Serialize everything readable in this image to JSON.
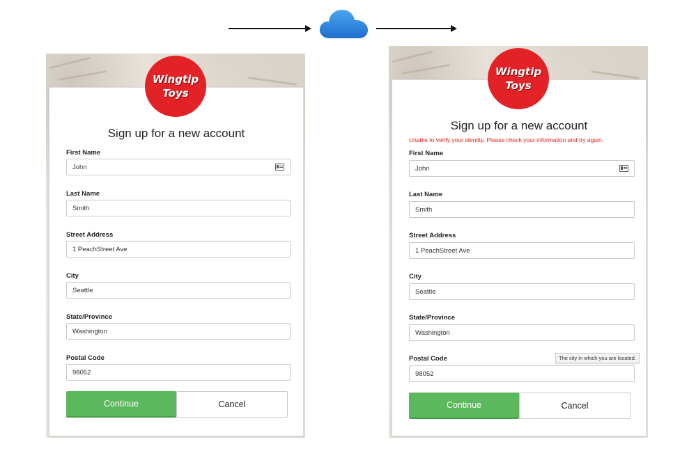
{
  "flow": {
    "cloud_icon": "cloud-icon",
    "cloud_color": "#2b87d9"
  },
  "brand": {
    "line1": "Wingtip",
    "line2": "Toys",
    "color": "#e32227"
  },
  "form": {
    "title": "Sign up for a new account",
    "fields": [
      {
        "label": "First Name",
        "value": "John"
      },
      {
        "label": "Last Name",
        "value": "Smith"
      },
      {
        "label": "Street Address",
        "value": "1 PeachStreet Ave"
      },
      {
        "label": "City",
        "value": "Seattle"
      },
      {
        "label": "State/Province",
        "value": "Washington"
      },
      {
        "label": "Postal Code",
        "value": "98052"
      }
    ],
    "continue_label": "Continue",
    "cancel_label": "Cancel"
  },
  "after": {
    "error": "Unable to verify your identity. Please check your information and try again.",
    "tooltip": "The city in which you are located."
  },
  "colors": {
    "continue": "#5cb85c",
    "error": "#e0241c"
  }
}
